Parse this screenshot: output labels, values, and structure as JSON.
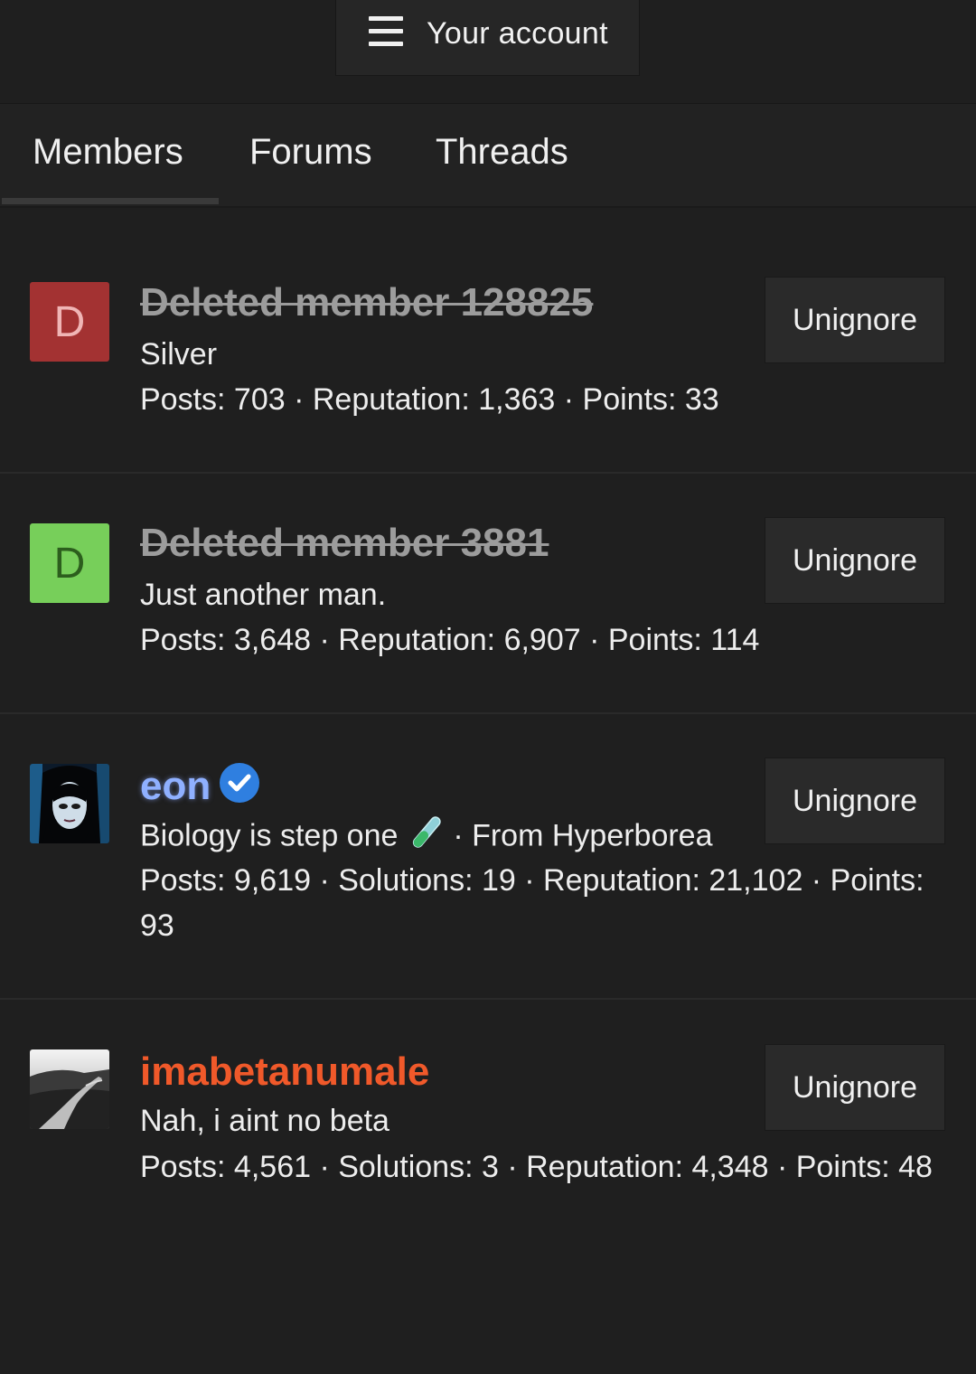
{
  "header": {
    "account_label": "Your account"
  },
  "tabs": [
    {
      "label": "Members",
      "active": true
    },
    {
      "label": "Forums",
      "active": false
    },
    {
      "label": "Threads",
      "active": false
    }
  ],
  "members": [
    {
      "name": "Deleted member 128825",
      "avatar_letter": "D",
      "avatar_color": "#a33232",
      "title": "Silver",
      "stats": "Posts: 703 · Reputation: 1,363 · Points: 33",
      "button": "Unignore"
    },
    {
      "name": "Deleted member 3881",
      "avatar_letter": "D",
      "avatar_color": "#77cf5a",
      "title": "Just another man.",
      "stats": "Posts: 3,648 · Reputation: 6,907 · Points: 114",
      "button": "Unignore"
    },
    {
      "name": "eon",
      "name_color": "#8fb0ff",
      "verified": true,
      "title": "Biology is step one",
      "location": "· From Hyperborea",
      "stats": "Posts: 9,619 · Solutions: 19 · Reputation: 21,102 · Points: 93",
      "button": "Unignore"
    },
    {
      "name": "imabetanumale",
      "name_color": "#f0592a",
      "title": "Nah, i aint no beta",
      "stats": "Posts: 4,561 · Solutions: 3 · Reputation: 4,348 · Points: 48",
      "button": "Unignore"
    }
  ]
}
